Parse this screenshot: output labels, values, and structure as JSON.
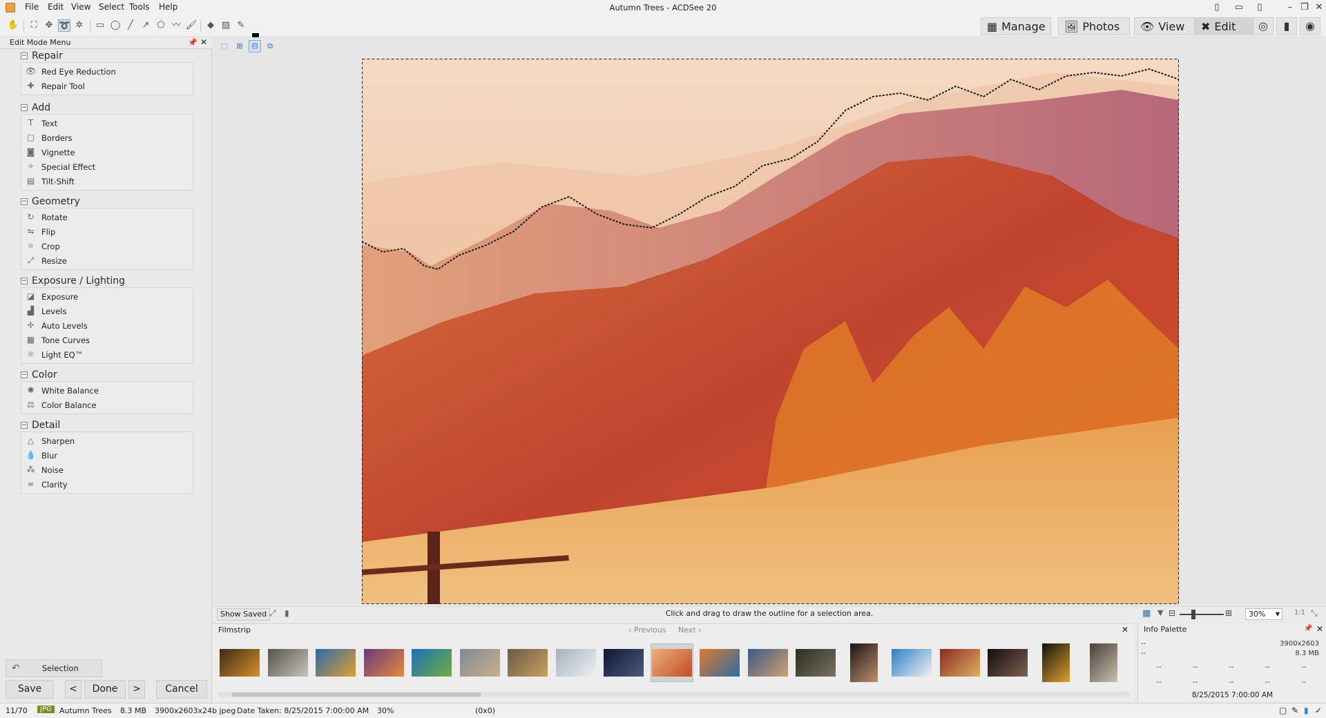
{
  "app": {
    "window_title": "Autumn Trees - ACDSee 20"
  },
  "menu": [
    "File",
    "Edit",
    "View",
    "Select",
    "Tools",
    "Help"
  ],
  "modes": {
    "manage": "Manage",
    "photos": "Photos",
    "view": "View",
    "edit": "Edit"
  },
  "edit_panel": {
    "title": "Edit Mode Menu",
    "groups": [
      {
        "name": "Repair",
        "items": [
          "Red Eye Reduction",
          "Repair Tool"
        ]
      },
      {
        "name": "Add",
        "items": [
          "Text",
          "Borders",
          "Vignette",
          "Special Effect",
          "Tilt-Shift"
        ]
      },
      {
        "name": "Geometry",
        "items": [
          "Rotate",
          "Flip",
          "Crop",
          "Resize"
        ]
      },
      {
        "name": "Exposure / Lighting",
        "items": [
          "Exposure",
          "Levels",
          "Auto Levels",
          "Tone Curves",
          "Light EQ™"
        ]
      },
      {
        "name": "Color",
        "items": [
          "White Balance",
          "Color Balance"
        ]
      },
      {
        "name": "Detail",
        "items": [
          "Sharpen",
          "Blur",
          "Noise",
          "Clarity"
        ]
      }
    ],
    "selection_label": "Selection",
    "save_label": "Save",
    "done_label": "Done",
    "cancel_label": "Cancel"
  },
  "canvas": {
    "show_saved": "Show Saved",
    "hint": "Click and drag to draw the outline for a selection area.",
    "zoom": "30%",
    "ratio": "1:1"
  },
  "filmstrip": {
    "title": "Filmstrip",
    "previous": "Previous",
    "next": "Next",
    "thumbs": [
      {
        "c1": "#3a2a18",
        "c2": "#d8902a"
      },
      {
        "c1": "#55514c",
        "c2": "#c9c4bb"
      },
      {
        "c1": "#2b6aa8",
        "c2": "#e0a030"
      },
      {
        "c1": "#6b3a7a",
        "c2": "#e58a3c"
      },
      {
        "c1": "#1e6fb8",
        "c2": "#6fae3c"
      },
      {
        "c1": "#7f8a96",
        "c2": "#c8b08a"
      },
      {
        "c1": "#6a5a48",
        "c2": "#c8a060"
      },
      {
        "c1": "#9fb3c0",
        "c2": "#f0f0f0"
      },
      {
        "c1": "#101830",
        "c2": "#4a5a80"
      },
      {
        "c1": "#e8b080",
        "c2": "#c84a22"
      },
      {
        "c1": "#e07a30",
        "c2": "#2a6ea0"
      },
      {
        "c1": "#3a5a8a",
        "c2": "#d0a070"
      },
      {
        "c1": "#2a3022",
        "c2": "#7a7060"
      },
      {
        "c1": "#1a1412",
        "c2": "#c09070"
      },
      {
        "c1": "#2a80c8",
        "c2": "#f0f0f0"
      },
      {
        "c1": "#8a2a20",
        "c2": "#e0b060"
      },
      {
        "c1": "#120c10",
        "c2": "#806050"
      },
      {
        "c1": "#10140c",
        "c2": "#e0a030"
      },
      {
        "c1": "#4a4036",
        "c2": "#c8c0b0"
      }
    ]
  },
  "info_palette": {
    "title": "Info Palette",
    "dash": "--",
    "dims": "3900x2603",
    "size": "8.3 MB",
    "date": "8/25/2015 7:00:00 AM"
  },
  "statusbar": {
    "index": "11/70",
    "format": "JPG",
    "name": "Autumn Trees",
    "size": "8.3 MB",
    "dims": "3900x2603x24b jpeg",
    "date_taken": "Date Taken: 8/25/2015 7:00:00 AM",
    "zoom": "30%",
    "coords": "(0x0)"
  },
  "colors": {
    "accent": "#2b6fb0",
    "selected_thumb": "#d2d2d2"
  }
}
